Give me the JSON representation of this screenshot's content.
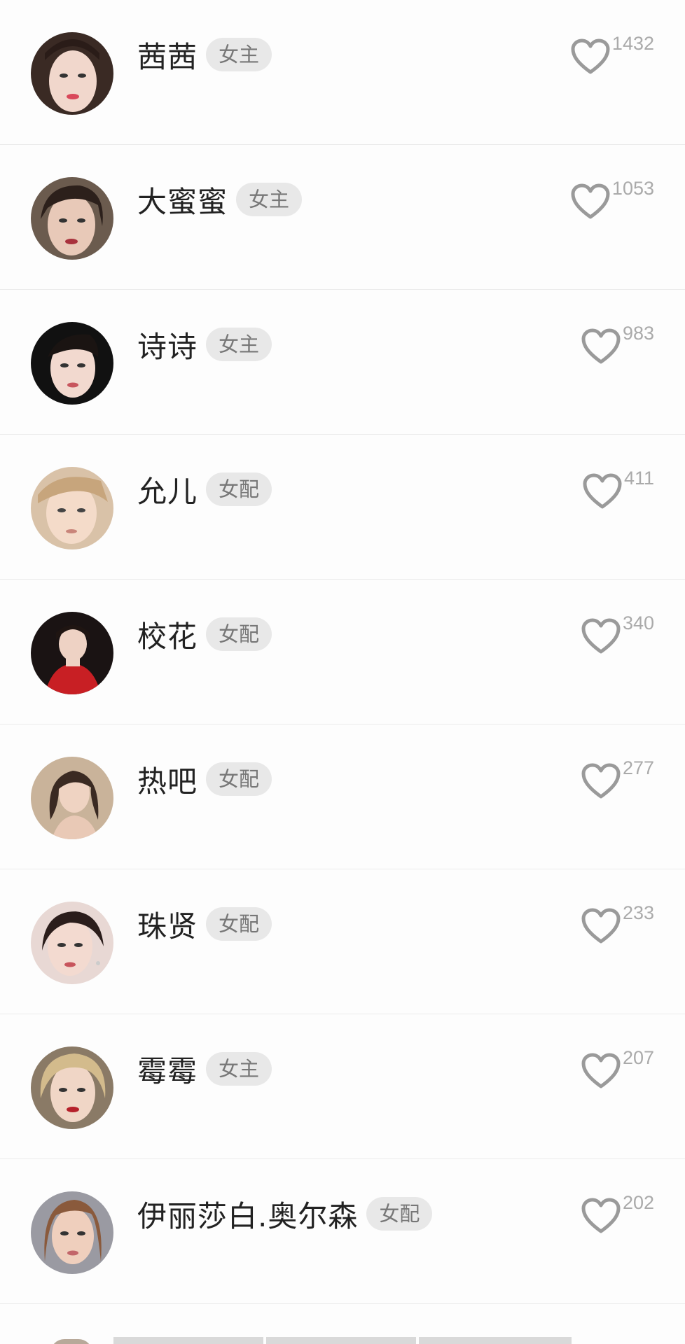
{
  "colors": {
    "background": "#fbfbfb",
    "tag_bg": "#e8e8e8",
    "tag_text": "#777777",
    "count_text": "#aaaaaa",
    "heart_stroke": "#9a9a9a"
  },
  "items": [
    {
      "name": "茜茜",
      "tag": "女主",
      "likes": "1432",
      "heart_icon": "heart-outline-icon"
    },
    {
      "name": "大蜜蜜",
      "tag": "女主",
      "likes": "1053",
      "heart_icon": "heart-outline-icon"
    },
    {
      "name": "诗诗",
      "tag": "女主",
      "likes": "983",
      "heart_icon": "heart-outline-icon"
    },
    {
      "name": "允儿",
      "tag": "女配",
      "likes": "411",
      "heart_icon": "heart-outline-icon"
    },
    {
      "name": "校花",
      "tag": "女配",
      "likes": "340",
      "heart_icon": "heart-outline-icon"
    },
    {
      "name": "热吧",
      "tag": "女配",
      "likes": "277",
      "heart_icon": "heart-outline-icon"
    },
    {
      "name": "珠贤",
      "tag": "女配",
      "likes": "233",
      "heart_icon": "heart-outline-icon"
    },
    {
      "name": "霉霉",
      "tag": "女主",
      "likes": "207",
      "heart_icon": "heart-outline-icon"
    },
    {
      "name": "伊丽莎白.奥尔森",
      "tag": "女配",
      "likes": "202",
      "heart_icon": "heart-outline-icon"
    }
  ]
}
